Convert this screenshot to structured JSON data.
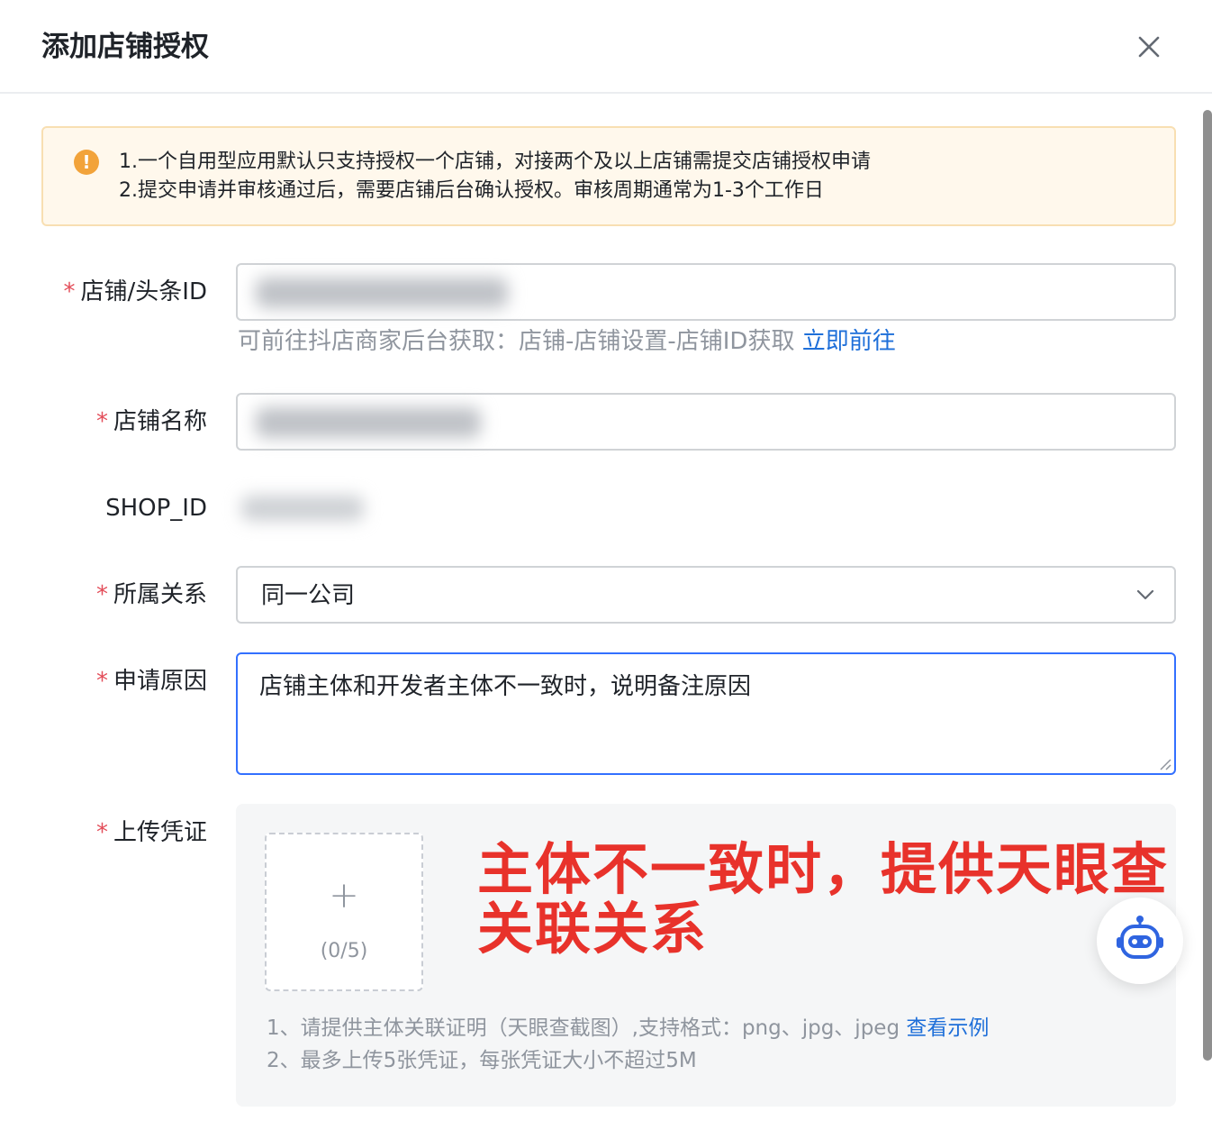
{
  "dialog": {
    "title": "添加店铺授权"
  },
  "alert": {
    "line1": "1.一个自用型应用默认只支持授权一个店铺，对接两个及以上店铺需提交店铺授权申请",
    "line2": "2.提交申请并审核通过后，需要店铺后台确认授权。审核周期通常为1-3个工作日"
  },
  "form": {
    "required_mark": "*",
    "shop_id": {
      "label": "店铺/头条ID",
      "hint": "可前往抖店商家后台获取：店铺-店铺设置-店铺ID获取",
      "hint_link": "立即前往"
    },
    "shop_name": {
      "label": "店铺名称"
    },
    "shop_id_display": {
      "label": "SHOP_ID"
    },
    "relation": {
      "label": "所属关系",
      "value": "同一公司"
    },
    "reason": {
      "label": "申请原因",
      "value": "店铺主体和开发者主体不一致时，说明备注原因"
    },
    "voucher": {
      "label": "上传凭证",
      "count": "(0/5)",
      "note1_text": "1、请提供主体关联证明（天眼查截图）,支持格式：png、jpg、jpeg",
      "note1_link": "查看示例",
      "note2": "2、最多上传5张凭证，每张凭证大小不超过5M"
    }
  },
  "annotation": {
    "text": "主体不一致时，提供天眼查关联关系",
    "color": "#e8322b"
  },
  "colors": {
    "link": "#1e6fd9",
    "required": "#e34d59",
    "warning": "#f2a33a",
    "focus_border": "#3370ff"
  },
  "icons": {
    "close": "close-icon",
    "alert": "exclamation-circle-icon",
    "chevron": "chevron-down-icon",
    "plus": "plus-icon",
    "assistant": "robot-icon"
  }
}
